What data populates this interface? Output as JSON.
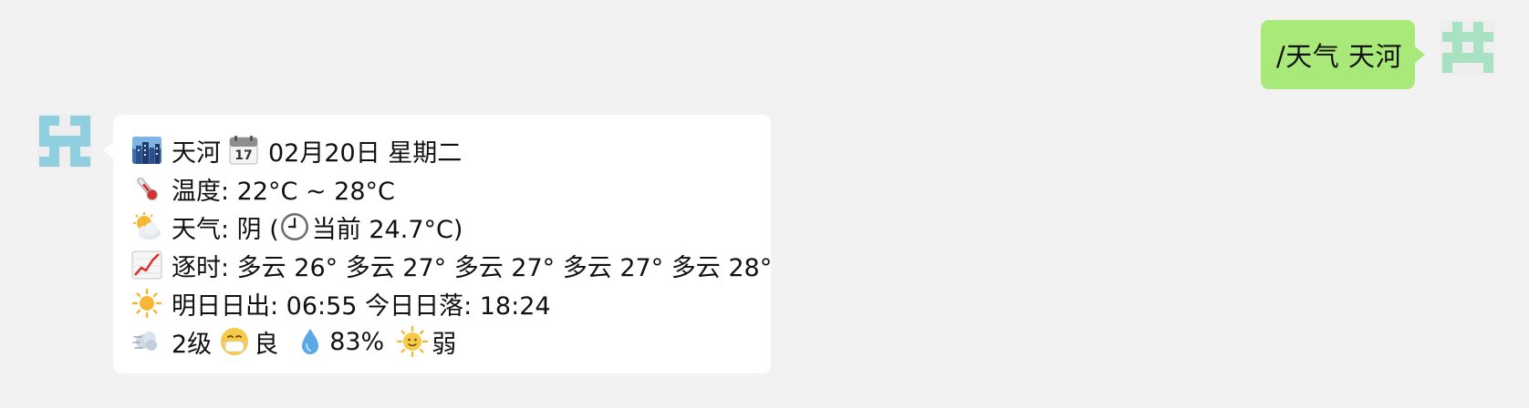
{
  "outgoing": {
    "text": "/天气 天河"
  },
  "reply": {
    "line1": {
      "icon": "cityscape-icon",
      "city": "天河",
      "icon2": "calendar-icon",
      "date": "02月20日 星期二"
    },
    "line2": {
      "icon": "thermometer-icon",
      "text": "温度: 22°C ~ 28°C"
    },
    "line3": {
      "icon": "sun-behind-cloud-icon",
      "prefix": "天气: 阴 (",
      "icon2": "clock-icon",
      "current": "当前 24.7°C)"
    },
    "line4": {
      "icon": "chart-increasing-icon",
      "text": "逐时: 多云 26° 多云 27° 多云 27° 多云 27° 多云 28°"
    },
    "line5": {
      "icon": "sun-icon",
      "text": "明日日出: 06:55 今日日落: 18:24"
    },
    "line6": {
      "icon": "wind-icon",
      "wind": "2级",
      "icon2": "mask-face-icon",
      "air": "良",
      "icon3": "droplet-icon",
      "humidity": "83%",
      "icon4": "sun-with-face-icon",
      "uv": "弱"
    }
  },
  "colors": {
    "background": "#f2f2f2",
    "outgoing_bubble": "#a9e97a",
    "incoming_bubble": "#ffffff",
    "avatar_me": "#a8e2c2",
    "avatar_bot": "#8fcfe0"
  }
}
